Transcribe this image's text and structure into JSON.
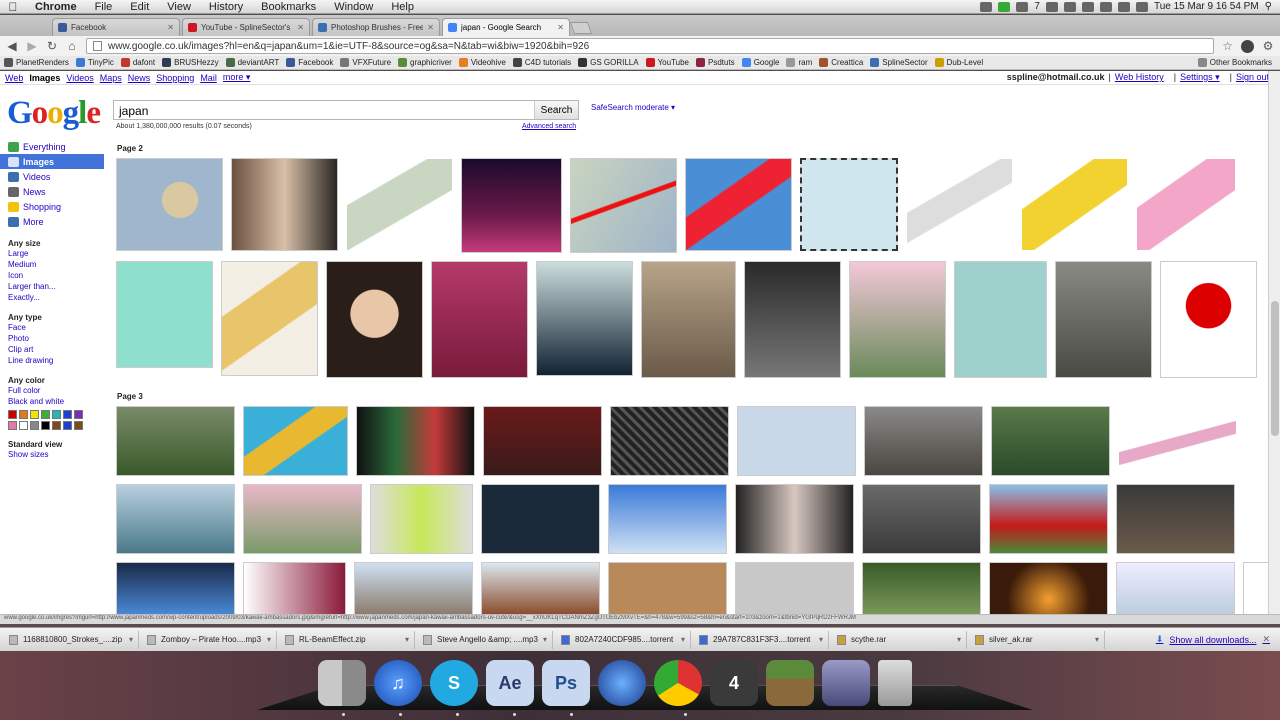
{
  "menubar": {
    "app": "Chrome",
    "items": [
      "File",
      "Edit",
      "View",
      "History",
      "Bookmarks",
      "Window",
      "Help"
    ],
    "clock": "Tue 15 Mar  9 16 54 PM",
    "num": "7"
  },
  "tabs": [
    {
      "label": "Facebook",
      "color": "#3b5998"
    },
    {
      "label": "YouTube - SplineSector's You",
      "color": "#cc181e"
    },
    {
      "label": "Photoshop Brushes - Free B",
      "color": "#3a6fb0"
    },
    {
      "label": "japan - Google Search",
      "color": "#4285f4"
    }
  ],
  "toolbar": {
    "url": "www.google.co.uk/images?hl=en&q=japan&um=1&ie=UTF-8&source=og&sa=N&tab=wi&biw=1920&bih=926"
  },
  "bookmarks": [
    {
      "label": "PlanetRenders",
      "color": "#555"
    },
    {
      "label": "TinyPic",
      "color": "#3a7bd5"
    },
    {
      "label": "dafont",
      "color": "#c0392b"
    },
    {
      "label": "BRUSHezzy",
      "color": "#2c3e50"
    },
    {
      "label": "deviantART",
      "color": "#4a6b4a"
    },
    {
      "label": "Facebook",
      "color": "#3b5998"
    },
    {
      "label": "VFXFuture",
      "color": "#777"
    },
    {
      "label": "graphicriver",
      "color": "#5b8c3a"
    },
    {
      "label": "Videohive",
      "color": "#e67e22"
    },
    {
      "label": "C4D tutorials",
      "color": "#444"
    },
    {
      "label": "GS GORILLA",
      "color": "#333"
    },
    {
      "label": "YouTube",
      "color": "#cc181e"
    },
    {
      "label": "Psdtuts",
      "color": "#8e2440"
    },
    {
      "label": "Google",
      "color": "#4285f4"
    },
    {
      "label": "ram",
      "color": "#999"
    },
    {
      "label": "Creattica",
      "color": "#a0522d"
    },
    {
      "label": "SplineSector",
      "color": "#3a6fb0"
    },
    {
      "label": "Dub-Level",
      "color": "#c8a000"
    }
  ],
  "other_bookmarks": "Other Bookmarks",
  "gbar": {
    "links": [
      "Web",
      "Images",
      "Videos",
      "Maps",
      "News",
      "Shopping",
      "Mail",
      "more ▾"
    ],
    "current": "Images",
    "user": "sspline@hotmail.co.uk",
    "web_history": "Web History",
    "settings": "Settings ▾",
    "signout": "Sign out"
  },
  "logo": "Google",
  "search": {
    "query": "japan",
    "button": "Search",
    "safesearch": "SafeSearch moderate ▾",
    "stats": "About 1,380,000,000 results (0.07 seconds)",
    "advanced": "Advanced search"
  },
  "sidebar": {
    "nav": [
      {
        "label": "Everything",
        "color": "#3fa34d"
      },
      {
        "label": "Images",
        "color": "#ffffff"
      },
      {
        "label": "Videos",
        "color": "#3a6fb0"
      },
      {
        "label": "News",
        "color": "#666666"
      },
      {
        "label": "Shopping",
        "color": "#f4c20d"
      },
      {
        "label": "More",
        "color": "#3a6fb0"
      }
    ],
    "size_head": "Any size",
    "sizes": [
      "Large",
      "Medium",
      "Icon",
      "Larger than...",
      "Exactly..."
    ],
    "type_head": "Any type",
    "types": [
      "Face",
      "Photo",
      "Clip art",
      "Line drawing"
    ],
    "color_head": "Any color",
    "colors_links": [
      "Full color",
      "Black and white"
    ],
    "swatches": [
      "#cc0000",
      "#e07a1f",
      "#f2e600",
      "#36b336",
      "#2ab5b5",
      "#1c3fd6",
      "#7a2fb3",
      "#e07aa6",
      "#ffffff",
      "#888888",
      "#000000",
      "#7a4b1f",
      "#1c3fd6",
      "#7a4b1f"
    ],
    "view_head": "Standard view",
    "show_sizes": "Show sizes"
  },
  "results": {
    "page2": "Page 2",
    "page3": "Page 3"
  },
  "statusbar": "www.google.co.uk/imgres?imgurl=http://www.japanmeds.com/wp-content/uploads/2009/03/kawaii-ambassadors.jpg&imgrefurl=http://www.japanmeds.com/japan-kawaii-ambassadors-uv-cute/&usg=__xXhUKLqTCDANmZ3ZgUTUEbZMXvTE=&h=478&w=599&sz=58&hl=en&start=103&zoom=1&tbnid=YGfPqRDzFFWRJM",
  "downloads": [
    "1168810800_Strokes_....zip",
    "Zomboy – Pirate Hoo....mp3",
    "RL-BeamEffect.zip",
    "Steve Angello &amp; ....mp3",
    "802A7240CDF985....torrent",
    "29A787C831F3F3....torrent",
    "scythe.rar",
    "silver_ak.rar"
  ],
  "show_all": "Show all downloads...",
  "dock": [
    {
      "name": "finder",
      "label": "",
      "color": "#8a8a8a"
    },
    {
      "name": "itunes",
      "label": "♫",
      "color": "#2a6fd6"
    },
    {
      "name": "skype",
      "label": "S",
      "color": "#23a9e1"
    },
    {
      "name": "after-effects",
      "label": "Ae",
      "color": "#2b3a6a"
    },
    {
      "name": "photoshop",
      "label": "Ps",
      "color": "#1f4e8c"
    },
    {
      "name": "blue-sphere",
      "label": "",
      "color": "#2a5a9a"
    },
    {
      "name": "chrome",
      "label": "",
      "color": "#e0e0e0"
    },
    {
      "name": "cinema4d",
      "label": "4",
      "color": "#444444"
    },
    {
      "name": "minecraft",
      "label": "",
      "color": "#5a8a3a"
    },
    {
      "name": "photo-booth",
      "label": "",
      "color": "#6a6a9a"
    },
    {
      "name": "trash",
      "label": "",
      "color": "#9a9a9a"
    }
  ]
}
